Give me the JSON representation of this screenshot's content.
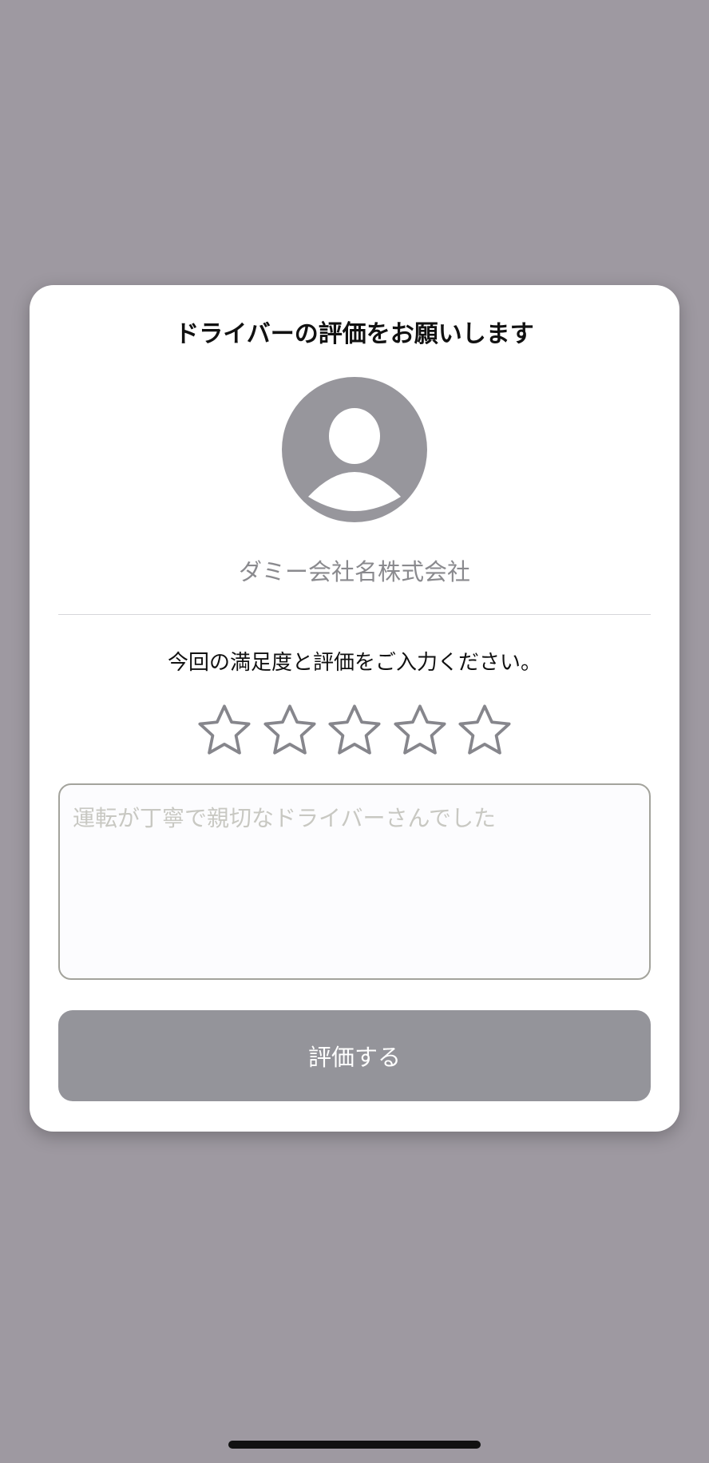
{
  "modal": {
    "title": "ドライバーの評価をお願いします",
    "avatar_icon": "user-avatar-icon",
    "company_name": "ダミー会社名株式会社",
    "prompt": "今回の満足度と評価をご入力ください。",
    "rating": {
      "value": 0,
      "max": 5,
      "star_icon": "star-outline-icon"
    },
    "comment": {
      "value": "",
      "placeholder": "運転が丁寧で親切なドライバーさんでした"
    },
    "submit_label": "評価する"
  },
  "colors": {
    "backdrop": "#9e99a1",
    "avatar_gray": "#97969c",
    "button_gray": "#94949a",
    "star_stroke": "#86868c"
  }
}
